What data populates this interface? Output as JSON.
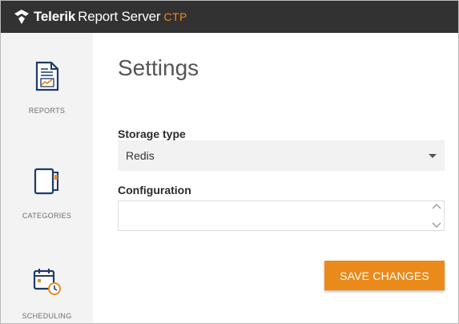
{
  "app": {
    "brand_bold": "Telerik",
    "brand_regular": "Report Server",
    "brand_tag": "CTP",
    "accent_color": "#e98a1b"
  },
  "sidebar": {
    "items": [
      {
        "label": "REPORTS",
        "icon": "report-document-icon"
      },
      {
        "label": "CATEGORIES",
        "icon": "categories-folder-icon"
      },
      {
        "label": "SCHEDULING",
        "icon": "calendar-clock-icon"
      }
    ]
  },
  "main": {
    "title": "Settings",
    "storage_type": {
      "label": "Storage type",
      "value": "Redis"
    },
    "configuration": {
      "label": "Configuration",
      "value": ""
    },
    "save_label": "SAVE CHANGES"
  }
}
